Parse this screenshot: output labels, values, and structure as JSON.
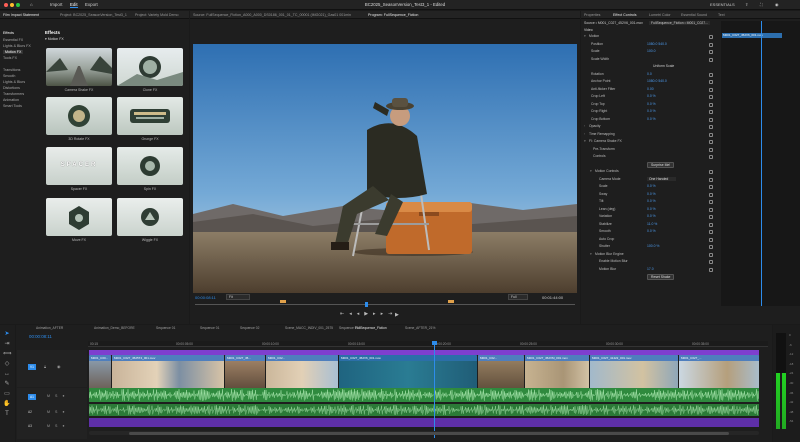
{
  "window": {
    "menu": [
      "Home",
      "Import",
      "Edit",
      "Export"
    ],
    "title": "BC2025_SeasonVersion_Test3_1 - Edited",
    "workspace": "ESSENTIALS"
  },
  "effects_panel": {
    "tabs": [
      "Film Impact Statement",
      "Project: BC2025_SeasonVersion_Test3_1",
      "Project: Variety Mold Demo"
    ],
    "header": "Effects",
    "root_category": "Effects",
    "categories": [
      "Essential FX",
      "Lights & Blurs FX",
      "Motion FX",
      "Tools FX",
      "Transitions",
      "Smooth",
      "Lights & Blurs",
      "Distortions",
      "Transformers",
      "Animation",
      "Smart Tools"
    ],
    "active_category_index": 2,
    "subheader": "▾ Motion FX",
    "thumbs": [
      {
        "label": "Camera Shake FX"
      },
      {
        "label": "Clone FX"
      },
      {
        "label": "3D Rotate FX"
      },
      {
        "label": "Grunge FX"
      },
      {
        "label": "Spacer FX",
        "overlay": "SPACER"
      },
      {
        "label": "Spin FX"
      },
      {
        "label": "Move FX"
      },
      {
        "label": "Wiggle FX"
      }
    ]
  },
  "monitor": {
    "source_tab": "Source: FullSequence_Fiction_A000_A000_DS0186_001_01_TC_00001 (IMG021)_Gas01 001min",
    "program_tab": "Program: FullSequence_Fiction",
    "timecode_in": "00:00:08:11",
    "fit": "Fit",
    "quality": "Full",
    "timecode_out": "00:01:44:00"
  },
  "effect_controls": {
    "tabs": [
      "Properties",
      "Effect Controls",
      "Lumetri Color",
      "Essential Sound",
      "Text"
    ],
    "active_tab_index": 1,
    "source": "Source • M001_C027_452V6_001.mov",
    "sequence": "FullSequence_Fiction • M001_C027...",
    "section": "Video",
    "rows": [
      {
        "label": "Motion",
        "value": "",
        "indent": 0,
        "chev": "▾"
      },
      {
        "label": "Position",
        "value": "1080.0   540.0",
        "indent": 2
      },
      {
        "label": "Scale",
        "value": "100.0",
        "indent": 2
      },
      {
        "label": "Scale Width",
        "value": "",
        "indent": 2
      },
      {
        "label": "",
        "value": "Uniform Scale",
        "indent": 16
      },
      {
        "label": "Rotation",
        "value": "0.0",
        "indent": 2
      },
      {
        "label": "Anchor Point",
        "value": "1080.0   540.0",
        "indent": 2
      },
      {
        "label": "Anti-flicker Filter",
        "value": "0.00",
        "indent": 2
      },
      {
        "label": "Crop Left",
        "value": "0.0 %",
        "indent": 2
      },
      {
        "label": "Crop Top",
        "value": "0.0 %",
        "indent": 2
      },
      {
        "label": "Crop Right",
        "value": "0.0 %",
        "indent": 2
      },
      {
        "label": "Crop Bottom",
        "value": "0.0 %",
        "indent": 2
      },
      {
        "label": "Opacity",
        "value": "",
        "indent": 0,
        "chev": "›"
      },
      {
        "label": "Time Remapping",
        "value": "",
        "indent": 0,
        "chev": "›"
      },
      {
        "label": "FI: Camera Shake FX",
        "value": "",
        "indent": 0,
        "chev": "▾"
      },
      {
        "label": "Pre-Transform",
        "value": "",
        "indent": 4
      },
      {
        "label": "Controls",
        "value": "",
        "indent": 4
      },
      {
        "label": "",
        "value": "Surprise Me!",
        "indent": 40,
        "button": true
      },
      {
        "label": "Motion Controls",
        "value": "",
        "indent": 6,
        "chev": "▾"
      },
      {
        "label": "Camera Mode",
        "value": "One Handed",
        "indent": 10,
        "dropdown": true
      },
      {
        "label": "Scale",
        "value": "0.0 %",
        "indent": 10
      },
      {
        "label": "Sway",
        "value": "0.0 %",
        "indent": 10
      },
      {
        "label": "Tilt",
        "value": "0.0 %",
        "indent": 10
      },
      {
        "label": "Lean (deg)",
        "value": "0.0 %",
        "indent": 10
      },
      {
        "label": "Variation",
        "value": "0.0 %",
        "indent": 10
      },
      {
        "label": "Stabilize",
        "value": "11.0 %",
        "indent": 10
      },
      {
        "label": "Smooth",
        "value": "0.0 %",
        "indent": 10
      },
      {
        "label": "Auto Crop",
        "value": "",
        "indent": 10
      },
      {
        "label": "Shutter",
        "value": "100.0 %",
        "indent": 10
      },
      {
        "label": "Motion Blur Engine",
        "value": "",
        "indent": 6,
        "chev": "▾"
      },
      {
        "label": "Enable Motion Blur",
        "value": "",
        "indent": 10
      },
      {
        "label": "Motion Blur",
        "value": "17.0",
        "indent": 10
      },
      {
        "label": "",
        "value": "Reset Shake",
        "indent": 40,
        "button": true
      }
    ],
    "mini_clip": "M001_C027_452V6_001.mov"
  },
  "timeline": {
    "tabs": [
      "Animation_AFTER",
      "Animation_Demo_BEFORE",
      "Sequence 01",
      "Sequence 01",
      "Sequence 02",
      "Scene_MACC_INDIV_001_2575",
      "Sequence 03",
      "FullSequence_Fiction",
      "Scene_AFTER_21%"
    ],
    "active_tab_index": 7,
    "timecode": "00:00:08:11",
    "ruler": [
      "00:15",
      "00:00:05:00",
      "00:00:10:00",
      "00:00:15:00",
      "00:00:20:00",
      "00:00:25:00",
      "00:00:30:00",
      "00:00:35:00",
      "00:00:40:00"
    ],
    "tracks": {
      "video": [
        "V1"
      ],
      "audio": [
        "A1",
        "A2",
        "A3"
      ]
    },
    "clips": [
      {
        "label": "M001_C00..."
      },
      {
        "label": "M001_C027_4525T4_001.mov"
      },
      {
        "label": "M001_C027_45..."
      },
      {
        "label": "M001_C02..."
      },
      {
        "label": "M001_C027_452V6_001.mov"
      },
      {
        "label": "M001_C02..."
      },
      {
        "label": "M001_C027_452VM_001.mov"
      },
      {
        "label": "M001_C027_41422_001.mov"
      },
      {
        "label": "M001_C027_..."
      }
    ],
    "meter_db": [
      "0",
      "-6",
      "-12",
      "-18",
      "-24",
      "-30",
      "-36",
      "-42",
      "-48",
      "-54"
    ]
  },
  "colors": {
    "accent": "#2d8ceb",
    "video_clip": "#4c8bd8",
    "audio_clip": "#2f8a3e",
    "fx_clip": "#7e3fcf",
    "playhead": "#2d8ceb"
  }
}
